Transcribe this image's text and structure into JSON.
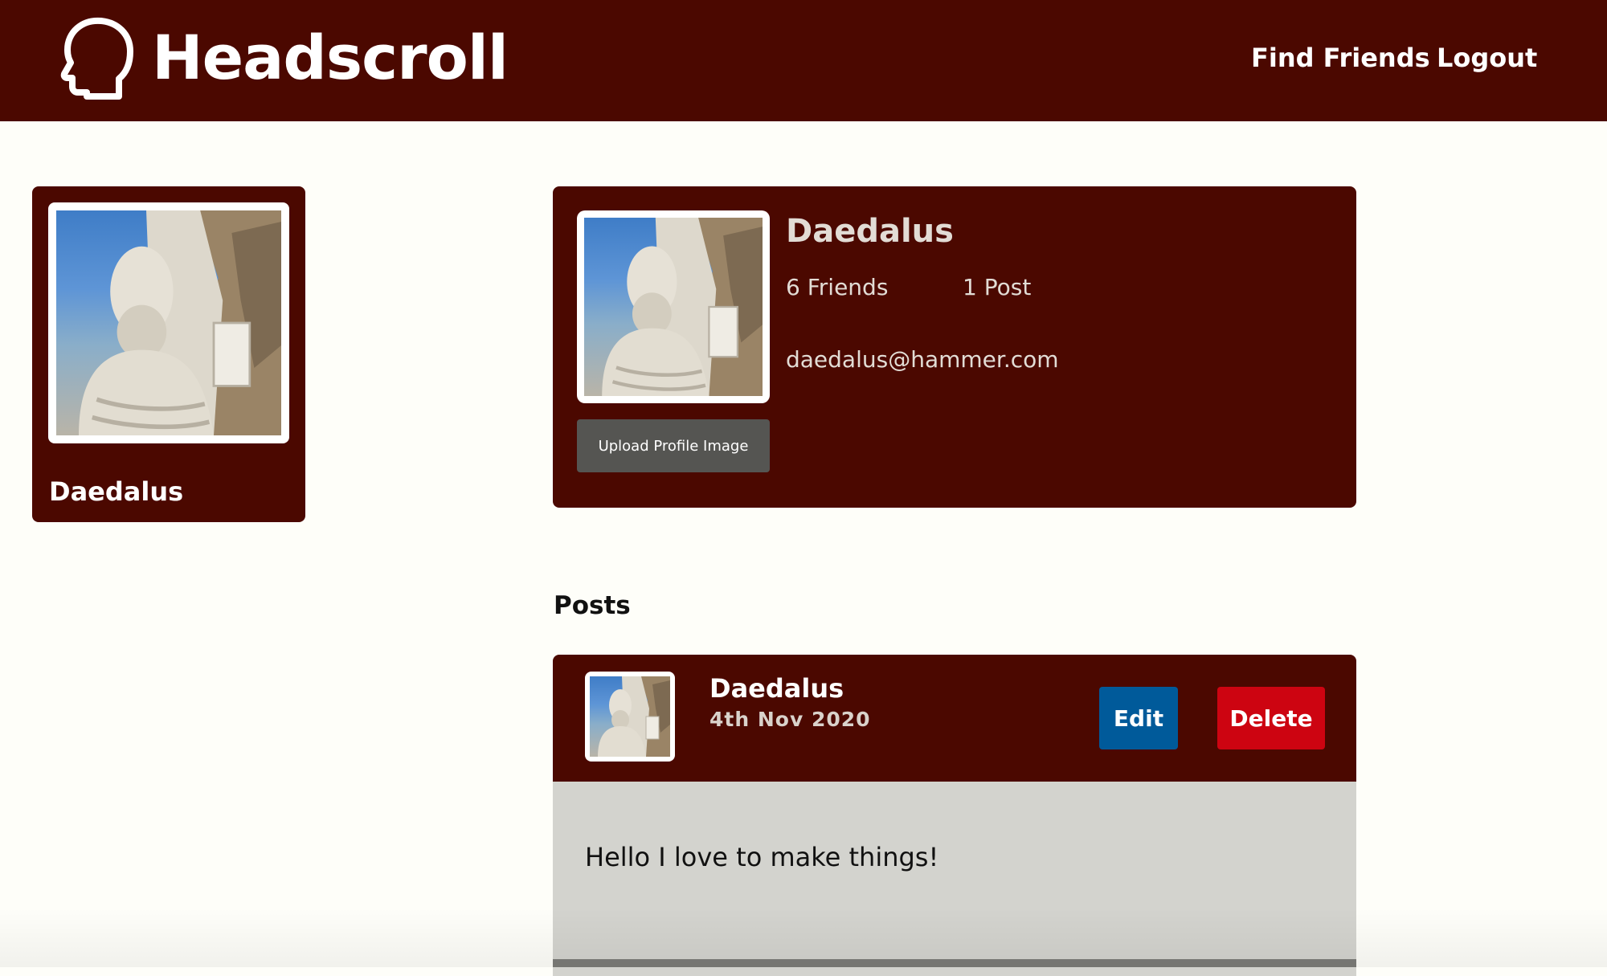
{
  "brand": {
    "title": "Headscroll",
    "logo_icon": "head-outline-icon"
  },
  "nav": {
    "find_friends": "Find Friends",
    "logout": "Logout"
  },
  "sidebar": {
    "name": "Daedalus",
    "avatar_icon": "statue-portrait"
  },
  "profile": {
    "name": "Daedalus",
    "friends": "6 Friends",
    "posts": "1 Post",
    "email": "daedalus@hammer.com",
    "upload_label": "Upload Profile Image"
  },
  "posts_section": {
    "heading": "Posts",
    "items": [
      {
        "author": "Daedalus",
        "date": "4th Nov 2020",
        "edit_label": "Edit",
        "delete_label": "Delete",
        "body": "Hello I love to make things!"
      }
    ]
  },
  "colors": {
    "header_bg": "#4b0800",
    "card_bg": "#4b0800",
    "page_bg": "#fefef9",
    "edit_btn": "#005a9a",
    "delete_btn": "#cd0411",
    "upload_btn": "#555552",
    "post_body_bg": "#d3d3ce"
  }
}
